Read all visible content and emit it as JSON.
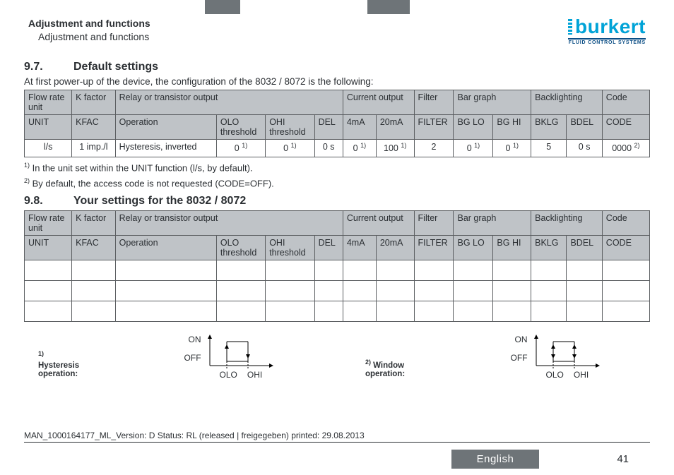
{
  "header": {
    "crumb_main": "Adjustment and functions",
    "crumb_sub": "Adjustment and functions",
    "brand": "burkert",
    "tagline": "FLUID CONTROL SYSTEMS"
  },
  "sec97": {
    "num": "9.7.",
    "title": "Default settings",
    "intro": "At first power-up of the device, the configuration of the 8032 / 8072 is the following:"
  },
  "table_groups": [
    "Flow rate unit",
    "K factor",
    "Relay or transistor output",
    "Current output",
    "Filter",
    "Bar graph",
    "Backlighting",
    "Code"
  ],
  "table_params": [
    "UNIT",
    "KFAC",
    "Operation",
    "OLO threshold",
    "OHI threshold",
    "DEL",
    "4mA",
    "20mA",
    "FILTER",
    "BG LO",
    "BG HI",
    "BKLG",
    "BDEL",
    "CODE"
  ],
  "defaults": {
    "unit": "l/s",
    "kfac": "1 imp./l",
    "operation": "Hysteresis, inverted",
    "olo": "0",
    "olo_sup": "1)",
    "ohi": "0",
    "ohi_sup": "1)",
    "del": "0 s",
    "i4": "0",
    "i4_sup": "1)",
    "i20": "100",
    "i20_sup": "1)",
    "filter": "2",
    "bglo": "0",
    "bglo_sup": "1)",
    "bghi": "0",
    "bghi_sup": "1)",
    "bklg": "5",
    "bdel": "0 s",
    "code": "0000",
    "code_sup": "2)"
  },
  "foot1_pre": "1)",
  "foot1_text": " In the unit set within the UNIT function (l/s, by default).",
  "foot2_pre": "2)",
  "foot2_text": " By default, the access code is not requested (CODE=OFF).",
  "sec98": {
    "num": "9.8.",
    "title": "Your settings for the 8032 / 8072"
  },
  "diag": {
    "on": "ON",
    "off": "OFF",
    "olo": "OLO",
    "ohi": "OHI",
    "hyst_pre": "1)",
    "hyst_label": " Hysteresis operation:",
    "win_pre": "2)",
    "win_label": " Window operation:"
  },
  "bottomline": "MAN_1000164177_ML_Version: D Status: RL (released | freigegeben)  printed: 29.08.2013",
  "language": "English",
  "page": "41"
}
